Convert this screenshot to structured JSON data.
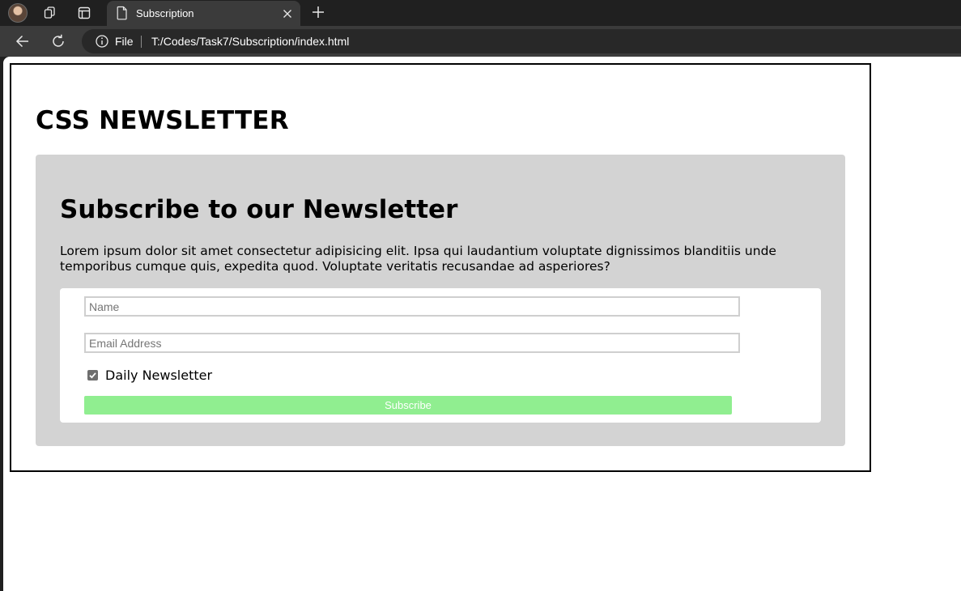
{
  "browser": {
    "tab_title": "Subscription",
    "url_scheme_label": "File",
    "url": "T:/Codes/Task7/Subscription/index.html",
    "icons": {
      "profile": "profile-avatar",
      "workspaces": "workspaces-icon",
      "tab_actions": "tab-actions-icon",
      "page": "page-icon",
      "close": "close-icon",
      "new_tab": "plus-icon",
      "back": "back-arrow-icon",
      "reload": "reload-icon",
      "info": "info-icon"
    }
  },
  "page": {
    "title": "CSS NEWSLETTER",
    "card": {
      "heading": "Subscribe to our Newsletter",
      "text": "Lorem ipsum dolor sit amet consectetur adipisicing elit. Ipsa qui laudantium voluptate dignissimos blanditiis unde temporibus cumque quis, expedita quod. Voluptate veritatis recusandae ad asperiores?",
      "form": {
        "name_placeholder": "Name",
        "name_value": "",
        "email_placeholder": "Email Address",
        "email_value": "",
        "checkbox_label": "Daily Newsletter",
        "checkbox_checked": true,
        "button_label": "Subscribe"
      }
    }
  },
  "colors": {
    "card_background": "#d3d3d3",
    "button_background": "#90ee90",
    "button_text": "#ffffff",
    "frame_border": "#000000"
  }
}
